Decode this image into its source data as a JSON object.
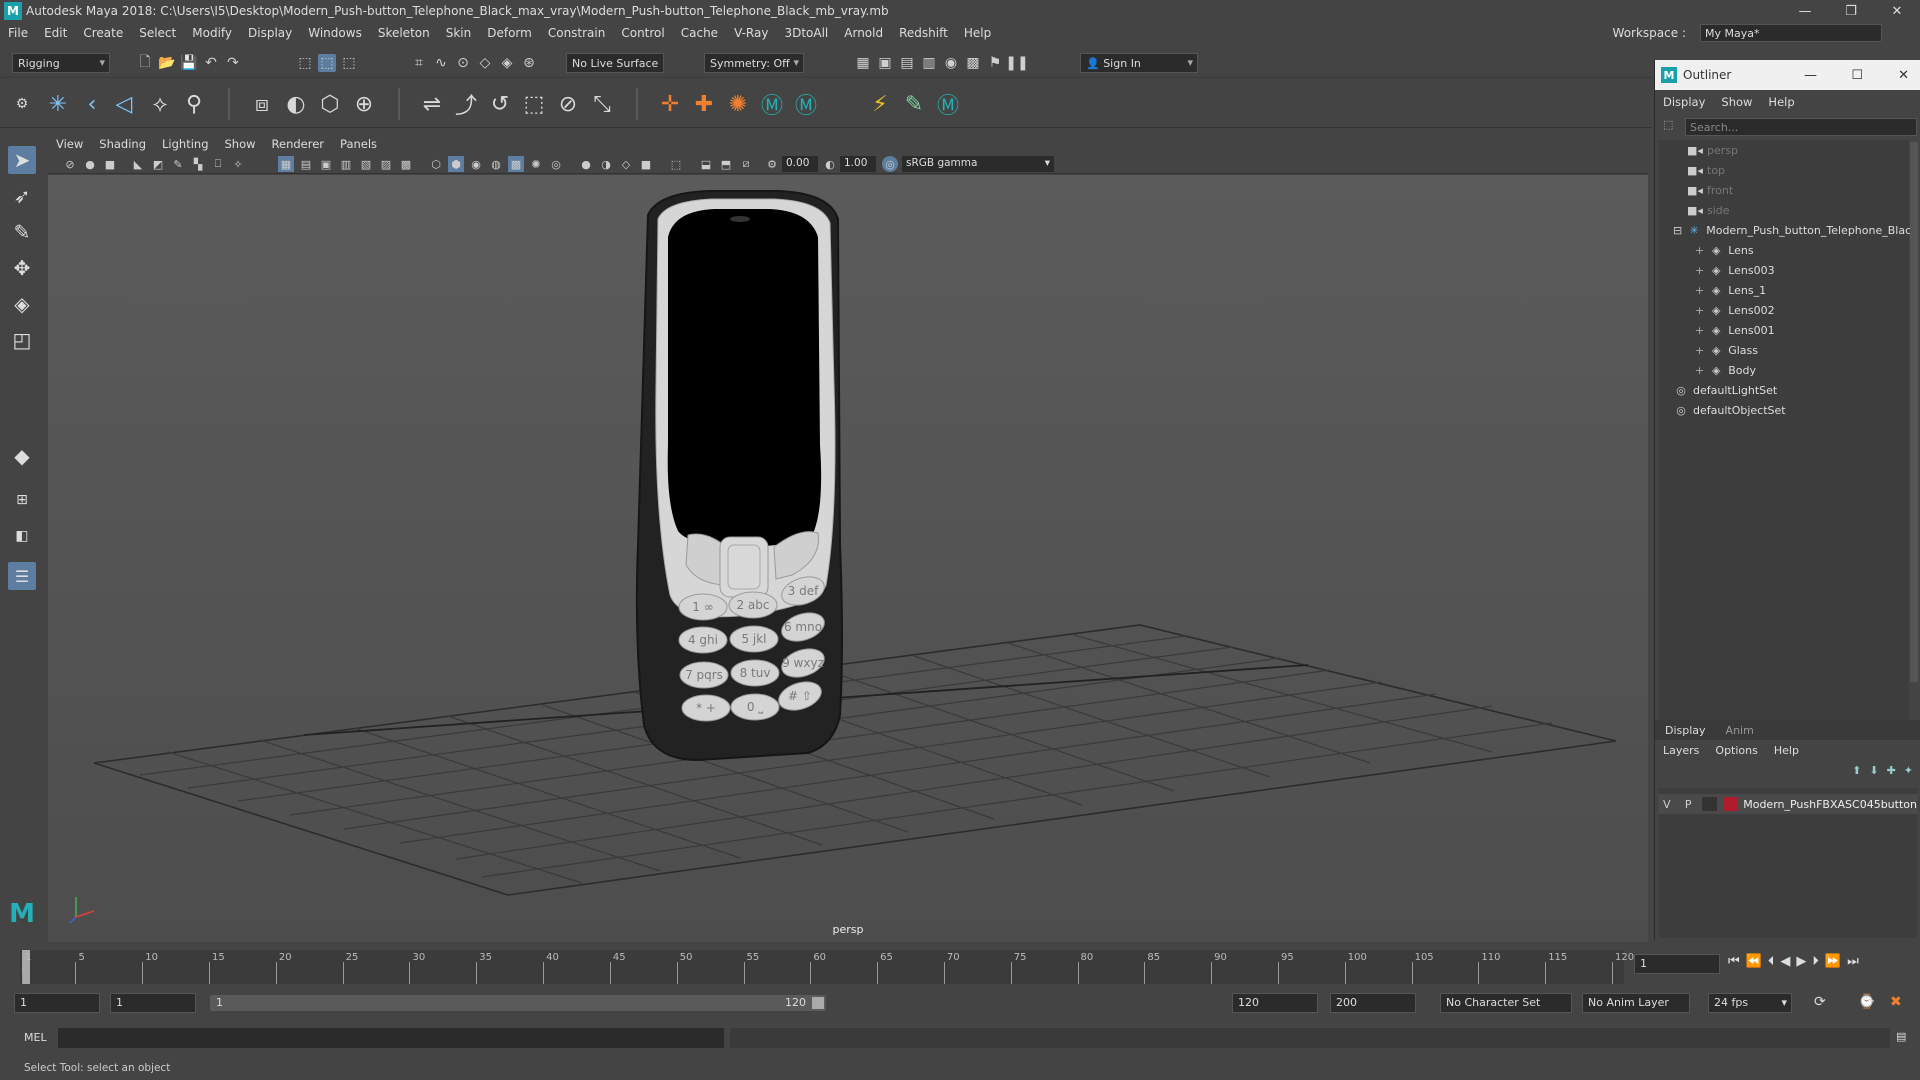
{
  "window": {
    "title": "Autodesk Maya 2018: C:\\Users\\I5\\Desktop\\Modern_Push-button_Telephone_Black_max_vray\\Modern_Push-button_Telephone_Black_mb_vray.mb",
    "minimize": "—",
    "restore": "❐",
    "close": "✕"
  },
  "menus": [
    "File",
    "Edit",
    "Create",
    "Select",
    "Modify",
    "Display",
    "Windows",
    "Skeleton",
    "Skin",
    "Deform",
    "Constrain",
    "Control",
    "Cache",
    "V-Ray",
    "3DtoAll",
    "Arnold",
    "Redshift",
    "Help"
  ],
  "workspace": {
    "label": "Workspace :",
    "value": "My Maya*"
  },
  "toolbar": {
    "mode": "Rigging",
    "live_surface": "No Live Surface",
    "symmetry": "Symmetry: Off",
    "sign_in": "Sign In"
  },
  "panel": {
    "menus": [
      "View",
      "Shading",
      "Lighting",
      "Show",
      "Renderer",
      "Panels"
    ],
    "exposure": "0.00",
    "gamma": "1.00",
    "color_space": "sRGB gamma",
    "camera_label": "persp"
  },
  "outliner": {
    "title": "Outliner",
    "menus": [
      "Display",
      "Show",
      "Help"
    ],
    "search_placeholder": "Search...",
    "items": [
      {
        "label": "persp",
        "type": "camera",
        "dim": true,
        "indent": 0
      },
      {
        "label": "top",
        "type": "camera",
        "dim": true,
        "indent": 0
      },
      {
        "label": "front",
        "type": "camera",
        "dim": true,
        "indent": 0
      },
      {
        "label": "side",
        "type": "camera",
        "dim": true,
        "indent": 0
      },
      {
        "label": "Modern_Push_button_Telephone_Black",
        "type": "group",
        "dim": false,
        "indent": 0
      },
      {
        "label": "Lens",
        "type": "mesh",
        "dim": false,
        "indent": 1
      },
      {
        "label": "Lens003",
        "type": "mesh",
        "dim": false,
        "indent": 1
      },
      {
        "label": "Lens_1",
        "type": "mesh",
        "dim": false,
        "indent": 1
      },
      {
        "label": "Lens002",
        "type": "mesh",
        "dim": false,
        "indent": 1
      },
      {
        "label": "Lens001",
        "type": "mesh",
        "dim": false,
        "indent": 1
      },
      {
        "label": "Glass",
        "type": "mesh",
        "dim": false,
        "indent": 1
      },
      {
        "label": "Body",
        "type": "mesh",
        "dim": false,
        "indent": 1
      },
      {
        "label": "defaultLightSet",
        "type": "set",
        "dim": false,
        "indent": 0
      },
      {
        "label": "defaultObjectSet",
        "type": "set",
        "dim": false,
        "indent": 0
      }
    ]
  },
  "layers": {
    "tabs": [
      "Display",
      "Anim"
    ],
    "menus": [
      "Layers",
      "Options",
      "Help"
    ],
    "row": {
      "v": "V",
      "p": "P",
      "name": "Modern_PushFBXASC045button",
      "color": "#b01c2e"
    }
  },
  "timeline": {
    "ticks": [
      1,
      5,
      10,
      15,
      20,
      25,
      30,
      35,
      40,
      45,
      50,
      55,
      60,
      65,
      70,
      75,
      80,
      85,
      90,
      95,
      100,
      105,
      110,
      115,
      120
    ],
    "current": "1"
  },
  "range": {
    "start": "1",
    "playback_start": "1",
    "slider_start": "1",
    "slider_end": "120",
    "playback_end": "120",
    "end": "200",
    "character_set": "No Character Set",
    "anim_layer": "No Anim Layer",
    "fps": "24 fps"
  },
  "command": {
    "label": "MEL"
  },
  "status": {
    "text": "Select Tool: select an object"
  },
  "phone": {
    "keys": [
      [
        "1 ∞",
        "2 abc",
        "3 def"
      ],
      [
        "4 ghi",
        "5 jkl",
        "6 mno"
      ],
      [
        "7 pqrs",
        "8 tuv",
        "9 wxyz"
      ],
      [
        "* +",
        "0 ⎵",
        "# ⇧"
      ]
    ]
  }
}
